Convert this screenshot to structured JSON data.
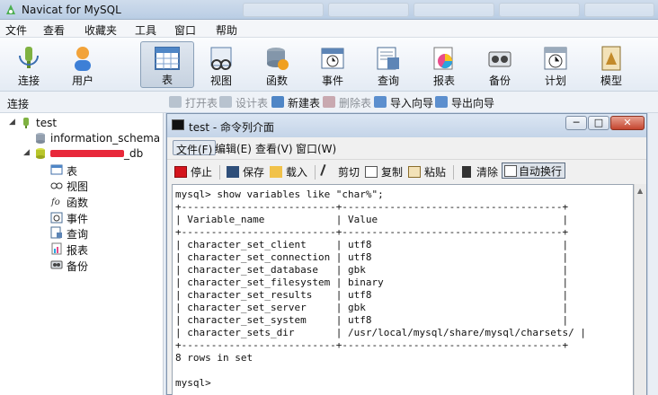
{
  "app": {
    "title": "Navicat for MySQL",
    "menu": [
      "文件",
      "查看",
      "收藏夹",
      "工具",
      "窗口",
      "帮助"
    ]
  },
  "toolbar": {
    "items": [
      {
        "label": "连接",
        "icon": "connection-icon"
      },
      {
        "label": "用户",
        "icon": "user-icon"
      },
      {
        "label": "表",
        "icon": "table-icon",
        "active": true
      },
      {
        "label": "视图",
        "icon": "view-icon"
      },
      {
        "label": "函数",
        "icon": "function-icon"
      },
      {
        "label": "事件",
        "icon": "event-icon"
      },
      {
        "label": "查询",
        "icon": "query-icon"
      },
      {
        "label": "报表",
        "icon": "report-icon"
      },
      {
        "label": "备份",
        "icon": "backup-icon"
      },
      {
        "label": "计划",
        "icon": "schedule-icon"
      },
      {
        "label": "模型",
        "icon": "model-icon"
      }
    ]
  },
  "sidebar": {
    "header": "连接",
    "connection": "test",
    "databases": [
      "information_schema",
      "_db"
    ],
    "db_children": [
      "表",
      "视图",
      "函数",
      "事件",
      "查询",
      "报表",
      "备份"
    ]
  },
  "subtoolbar": [
    "打开表",
    "设计表",
    "新建表",
    "删除表",
    "导入向导",
    "导出向导"
  ],
  "console": {
    "title": "test - 命令列介面",
    "menu": [
      "文件(F)",
      "编辑(E)",
      "查看(V)",
      "窗口(W)"
    ],
    "tools": [
      "停止",
      "保存",
      "载入",
      "剪切",
      "复制",
      "粘贴",
      "清除",
      "自动换行"
    ],
    "win_buttons": [
      "─",
      "□",
      "✕"
    ],
    "lines": [
      "mysql> show variables like \"char%\";",
      "+--------------------------+-------------------------------------+",
      "| Variable_name            | Value                               |",
      "+--------------------------+-------------------------------------+",
      "| character_set_client     | utf8                                |",
      "| character_set_connection | utf8                                |",
      "| character_set_database   | gbk                                 |",
      "| character_set_filesystem | binary                              |",
      "| character_set_results    | utf8                                |",
      "| character_set_server     | gbk                                 |",
      "| character_set_system     | utf8                                |",
      "| character_sets_dir       | /usr/local/mysql/share/mysql/charsets/ |",
      "+--------------------------+-------------------------------------+",
      "8 rows in set",
      "",
      "mysql>"
    ]
  },
  "colors": {
    "accent": "#c4d4e8",
    "redact": "#e8283a",
    "stop": "#d4141c"
  }
}
